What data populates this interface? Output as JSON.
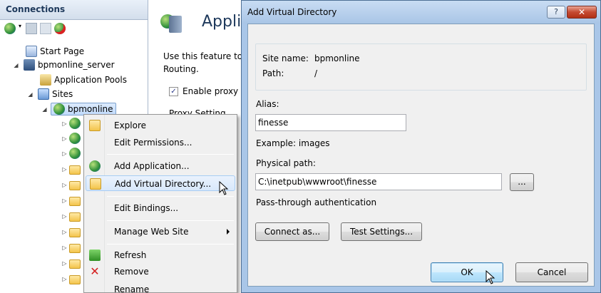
{
  "connections": {
    "header": "Connections",
    "tree": {
      "start_page": "Start Page",
      "server": "bpmonline_server",
      "app_pools": "Application Pools",
      "sites": "Sites",
      "site": "bpmonline"
    }
  },
  "feature_pane": {
    "title": "Applic",
    "description_line1": "Use this feature to",
    "description_line2": "Routing.",
    "checkbox_label": "Enable proxy",
    "checkbox_checked": "✓",
    "proxy_setting": "Proxy Setting"
  },
  "context_menu": {
    "items": [
      {
        "label": "Explore",
        "icon": "explore-icon"
      },
      {
        "label": "Edit Permissions...",
        "icon": ""
      },
      {
        "label": "Add Application...",
        "icon": "add-application-icon"
      },
      {
        "label": "Add Virtual Directory...",
        "icon": "add-virtual-directory-icon"
      },
      {
        "label": "Edit Bindings...",
        "icon": ""
      },
      {
        "label": "Manage Web Site",
        "icon": "",
        "submenu": true
      },
      {
        "label": "Refresh",
        "icon": "refresh-icon"
      },
      {
        "label": "Remove",
        "icon": "remove-icon"
      },
      {
        "label": "Rename",
        "icon": ""
      }
    ]
  },
  "dialog": {
    "title": "Add Virtual Directory",
    "help_label": "?",
    "close_label": "✕",
    "site_name_label": "Site name:",
    "site_name_value": "bpmonline",
    "path_label": "Path:",
    "path_value": "/",
    "alias_label": "Alias:",
    "alias_value": "finesse",
    "alias_example": "Example: images",
    "physical_path_label": "Physical path:",
    "physical_path_value": "C:\\inetpub\\wwwroot\\finesse",
    "browse_label": "...",
    "passthrough_label": "Pass-through authentication",
    "connect_as_label": "Connect as...",
    "test_settings_label": "Test Settings...",
    "ok_label": "OK",
    "cancel_label": "Cancel"
  },
  "colors": {
    "dialog_frame": "#a9c6e8",
    "menu_highlight": "#d8e8fb",
    "close_button": "#c54a32"
  }
}
